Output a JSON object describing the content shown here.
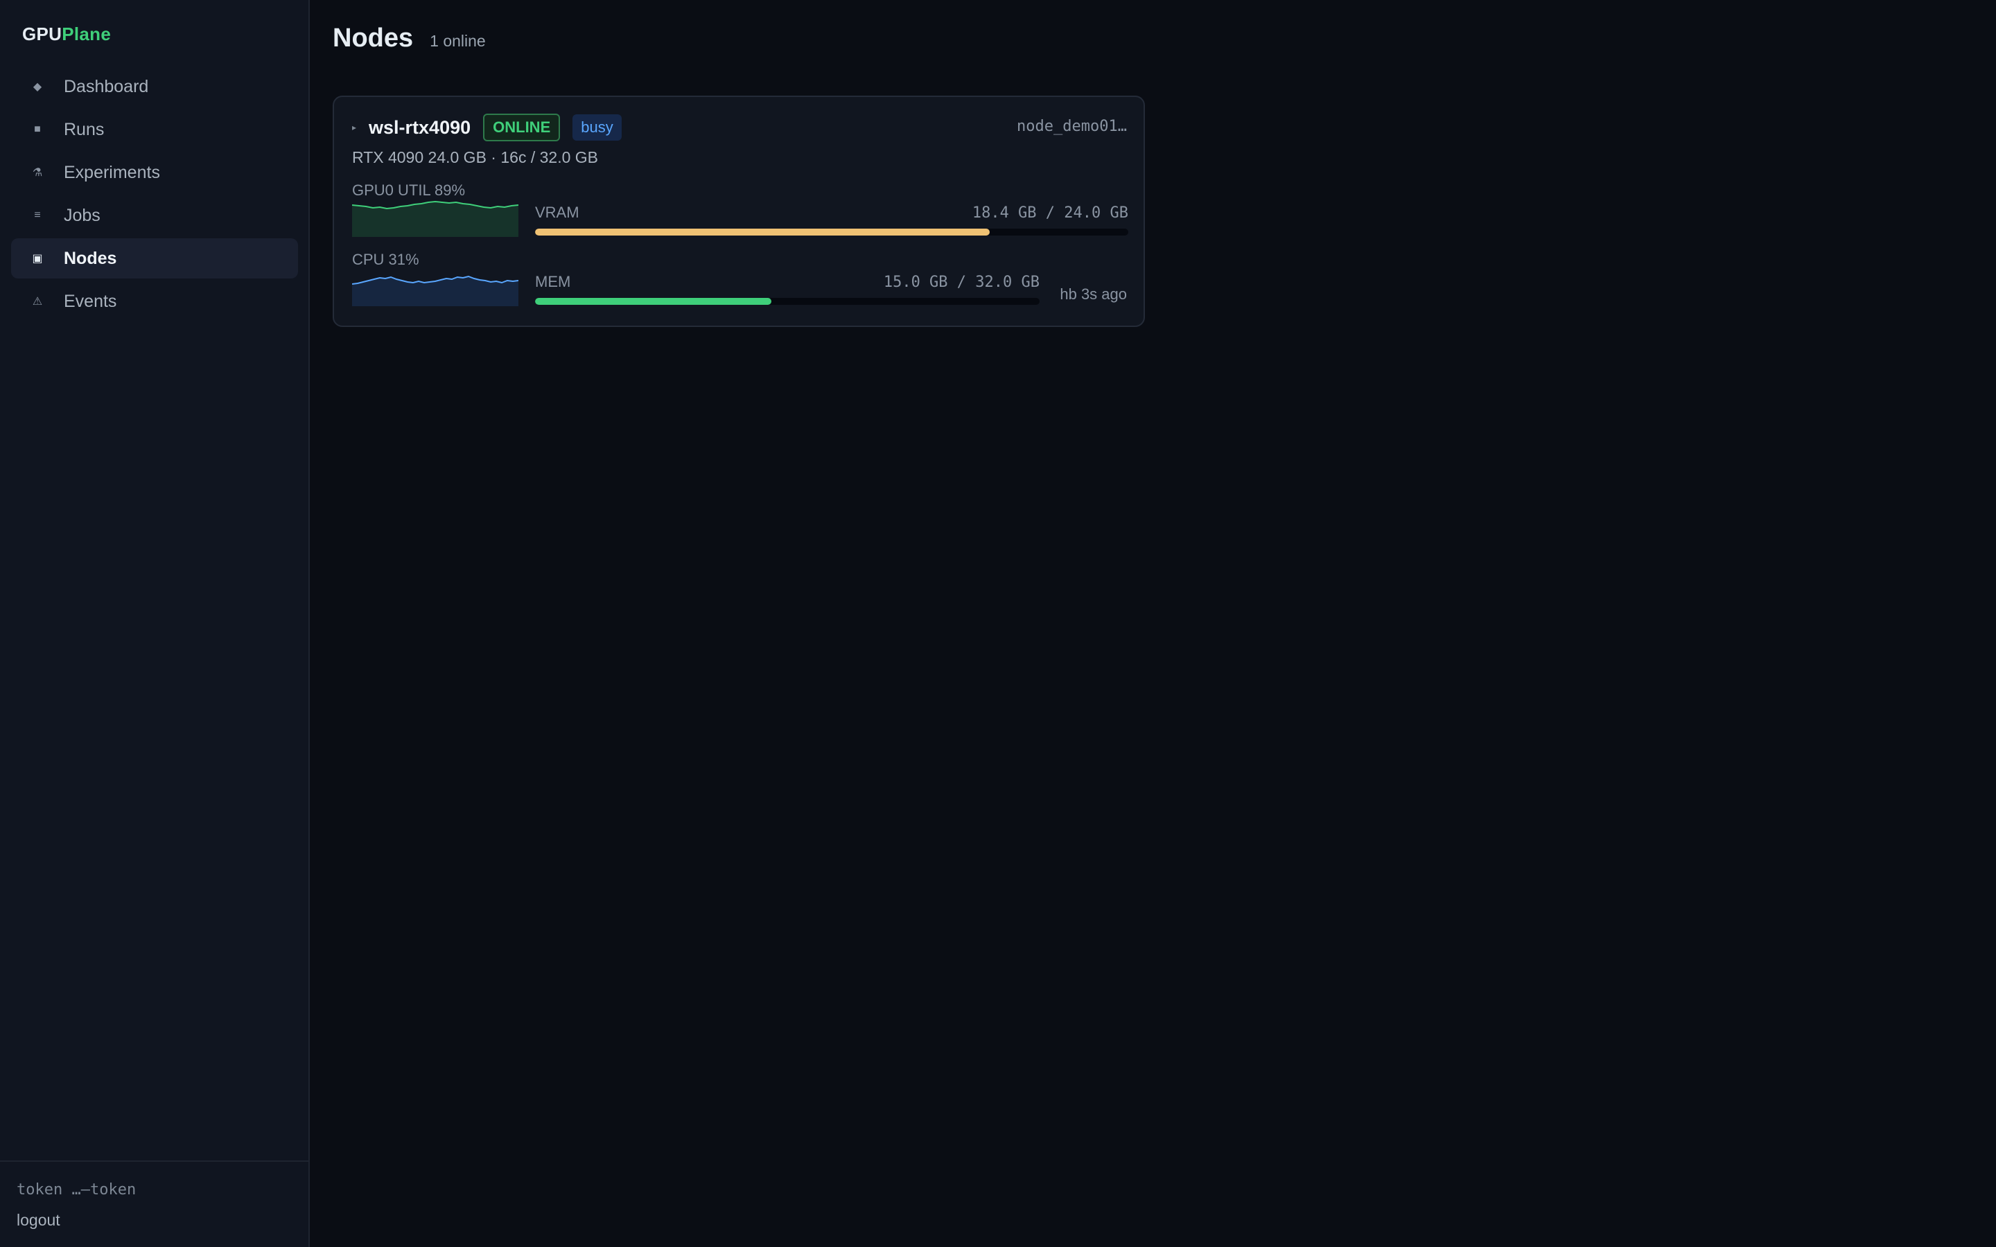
{
  "brand": {
    "part1": "GPU",
    "part2": "Plane"
  },
  "sidebar": {
    "items": [
      {
        "label": "Dashboard",
        "icon": "diamond-icon",
        "glyph": "◆",
        "active": false
      },
      {
        "label": "Runs",
        "icon": "square-icon",
        "glyph": "■",
        "active": false
      },
      {
        "label": "Experiments",
        "icon": "flask-icon",
        "glyph": "⚗",
        "active": false
      },
      {
        "label": "Jobs",
        "icon": "list-icon",
        "glyph": "≡",
        "active": false
      },
      {
        "label": "Nodes",
        "icon": "node-icon",
        "glyph": "▣",
        "active": true
      },
      {
        "label": "Events",
        "icon": "warning-icon",
        "glyph": "⚠",
        "active": false
      }
    ],
    "footer": {
      "token": "token …—token",
      "logout": "logout"
    }
  },
  "page": {
    "title": "Nodes",
    "subtitle": "1 online"
  },
  "node": {
    "name": "wsl-rtx4090",
    "status": "ONLINE",
    "state": "busy",
    "id": "node_demo01…",
    "specs": "RTX 4090 24.0 GB · 16c / 32.0 GB",
    "gpu_label": "GPU0 UTIL 89%",
    "cpu_label": "CPU 31%",
    "vram": {
      "name": "VRAM",
      "value": "18.4 GB / 24.0 GB",
      "used": 18.4,
      "total": 24.0
    },
    "mem": {
      "name": "MEM",
      "value": "15.0 GB / 32.0 GB",
      "used": 15.0,
      "total": 32.0
    },
    "heartbeat": "hb 3s ago"
  },
  "colors": {
    "accent_green": "#3fcf7a",
    "accent_blue": "#5aa7ff",
    "vram_bar": "#f0c274",
    "mem_bar": "#3fcf7a"
  }
}
